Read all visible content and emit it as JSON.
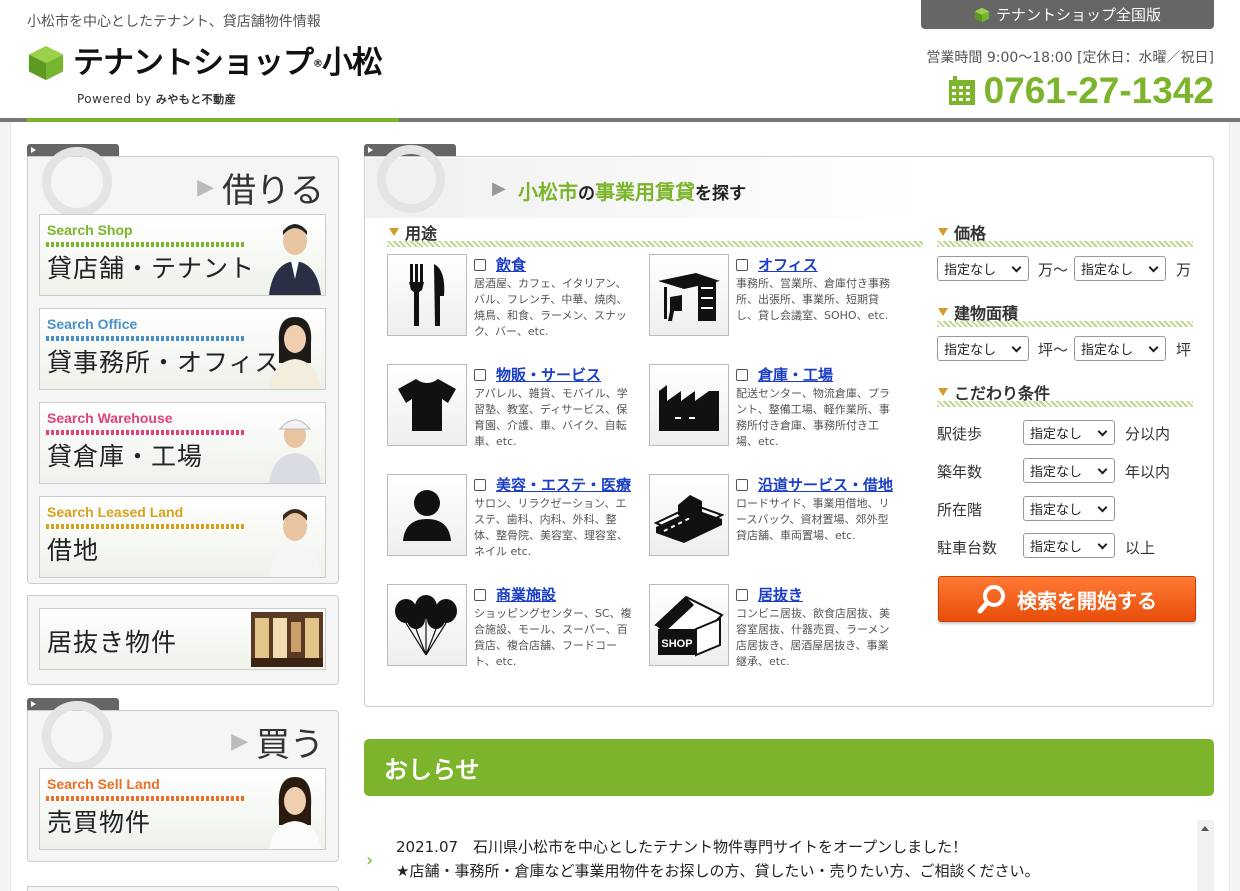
{
  "header": {
    "tagline": "小松市を中心としたテナント、貸店舗物件情報",
    "logo_title": "テナントショップ",
    "logo_mark": "®",
    "logo_city": "小松",
    "powered_prefix": "Powered by",
    "powered_company": "みやもと不動産",
    "national_link": "テナントショップ全国版",
    "hours": "営業時間 9:00～18:00 [定休日：水曜／祝日]",
    "phone": "0761-27-1342"
  },
  "sidebar": {
    "rent_heading": "借りる",
    "rent_items": [
      {
        "sub": "Search Shop",
        "title": "貸店舗・テナント",
        "color": "#7cb52b"
      },
      {
        "sub": "Search Office",
        "title": "貸事務所・オフィス",
        "color": "#4a90c8"
      },
      {
        "sub": "Search Warehouse",
        "title": "貸倉庫・工場",
        "color": "#e0427c"
      },
      {
        "sub": "Search Leased Land",
        "title": "借地",
        "color": "#d6a21e"
      }
    ],
    "inuki": "居抜き物件",
    "buy_heading": "買う",
    "buy_items": [
      {
        "sub": "Search Sell Land",
        "title": "売買物件",
        "color": "#e8702a"
      }
    ]
  },
  "search": {
    "title_city": "小松市",
    "title_no": "の",
    "title_rental": "事業用賃貸",
    "title_suffix": "を探す",
    "use_label": "用途",
    "categories": [
      {
        "name": "飲食",
        "desc": "居酒屋、カフェ、イタリアン、バル、フレンチ、中華、焼肉、焼鳥、和食、ラーメン、スナック、バー、etc.",
        "icon": "fork-knife-icon"
      },
      {
        "name": "オフィス",
        "desc": "事務所、営業所、倉庫付き事務所、出張所、事業所、短期貸し、貸し会議室、SOHO、etc.",
        "icon": "desk-icon"
      },
      {
        "name": "物販・サービス",
        "desc": "アパレル、雑貨、モバイル、学習塾、教室、ディサービス、保育園、介護、車、バイク、自転車、etc.",
        "icon": "tshirt-icon"
      },
      {
        "name": "倉庫・工場",
        "desc": "配送センター、物流倉庫、プラント、整備工場、軽作業所、事務所付き倉庫、事務所付き工場、etc.",
        "icon": "factory-icon"
      },
      {
        "name": "美容・エステ・医療",
        "desc": "サロン、リラクゼーション、エステ、歯科、内科、外科、整体、整骨院、美容室、理容室、ネイル etc.",
        "icon": "person-icon"
      },
      {
        "name": "沿道サービス・借地",
        "desc": "ロードサイド、事業用借地、リースバック、資材置場、郊外型貸店舗、車両置場、etc.",
        "icon": "roadside-icon"
      },
      {
        "name": "商業施設",
        "desc": "ショッピングセンター、SC、複合施設、モール、スーパー、百貨店、複合店舗、フードコート、etc.",
        "icon": "balloons-icon"
      },
      {
        "name": "居抜き",
        "desc": "コンビニ居抜、飲食店居抜、美容室居抜、什器売買、ラーメン店居抜き、居酒屋居抜き、事業継承、etc.",
        "icon": "shop-house-icon"
      }
    ],
    "shop_icon_text": "SHOP",
    "price_label": "価格",
    "area_label": "建物面積",
    "cond_label": "こだわり条件",
    "select_default": "指定なし",
    "price_unit_mid": "万～",
    "price_unit_end": "万",
    "area_unit_mid": "坪～",
    "area_unit_end": "坪",
    "conditions": [
      {
        "label": "駅徒歩",
        "unit": "分以内"
      },
      {
        "label": "築年数",
        "unit": "年以内"
      },
      {
        "label": "所在階",
        "unit": ""
      },
      {
        "label": "駐車台数",
        "unit": "以上"
      }
    ],
    "search_button": "検索を開始する"
  },
  "news": {
    "heading": "おしらせ",
    "line1": "2021.07　石川県小松市を中心としたテナント物件専門サイトをオープンしました！",
    "line2": "★店舗・事務所・倉庫など事業用物件をお探しの方、貸したい・売りたい方、ご相談ください。"
  }
}
